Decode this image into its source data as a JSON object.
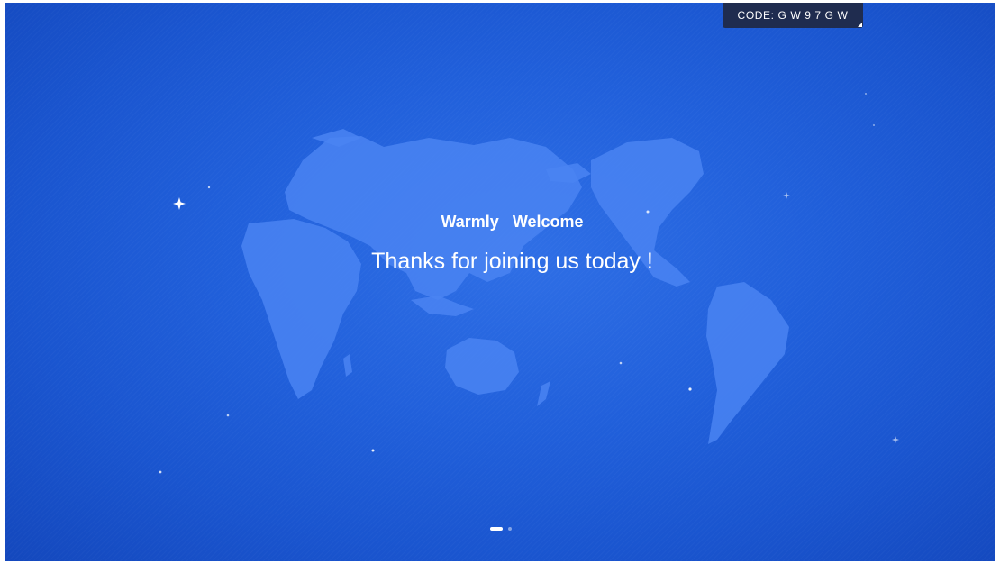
{
  "code_badge": {
    "text": "CODE:  G W 9 7 G W"
  },
  "welcome": {
    "title": "Warmly   Welcome",
    "subtitle": "Thanks for joining us today !"
  },
  "pagination": {
    "total_pages": 2,
    "current_page": 1
  },
  "colors": {
    "background": "#2160db",
    "continent": "#4a84f2",
    "badge": "#1f2c4f",
    "text": "#ffffff"
  }
}
